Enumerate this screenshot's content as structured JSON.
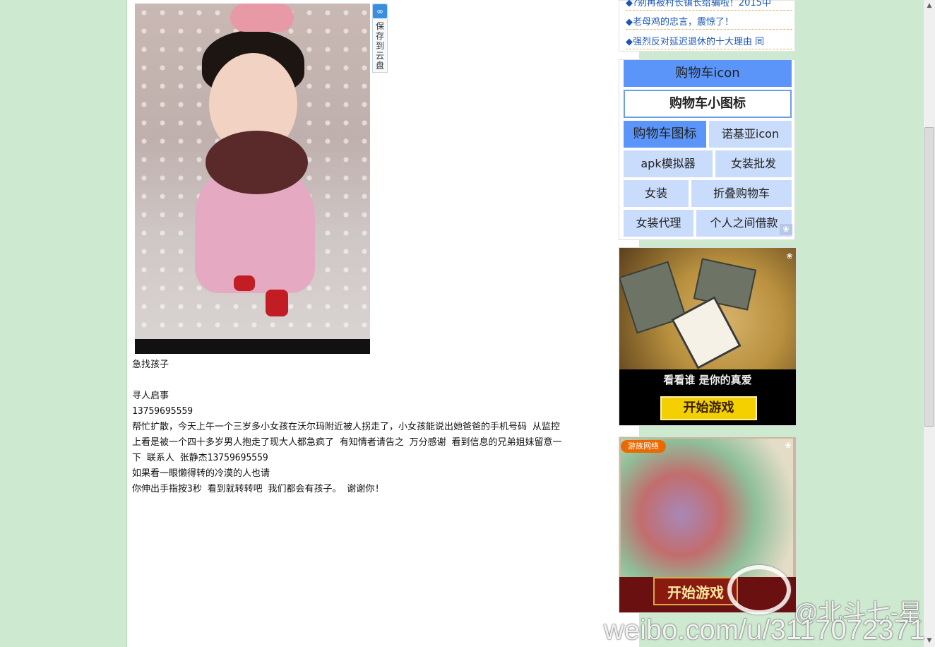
{
  "article": {
    "save_to_cloud": "保存到云盘",
    "lines": [
      "急找孩子",
      "",
      "寻人启事",
      "13759695559",
      "帮忙扩散，今天上午一个三岁多小女孩在沃尔玛附近被人拐走了，小女孩能说出她爸爸的手机号码 从监控",
      "上看是被一个四十多岁男人抱走了现大人都急疯了 有知情者请告之 万分感谢 看到信息的兄弟姐妹留意一",
      "下 联系人 张静杰13759695559",
      "如果看一眼懒得转的冷漠的人也请",
      "你伸出手指按3秒 看到就转转吧 我们都会有孩子。 谢谢你!"
    ]
  },
  "sidebar": {
    "news": [
      {
        "bullet": "◆",
        "text": "?别再被村长镇长给骗啦！2015中"
      },
      {
        "bullet": "◆",
        "text": "老母鸡的忠言，震惊了！"
      },
      {
        "bullet": "◆",
        "text": "强烈反对延迟退休的十大理由 同"
      }
    ],
    "links": [
      {
        "label": "购物车icon"
      },
      {
        "label": "购物车小图标"
      },
      {
        "label": "购物车图标"
      },
      {
        "label": "诺基亚icon"
      },
      {
        "label": "apk模拟器"
      },
      {
        "label": "女装批发"
      },
      {
        "label": "女装"
      },
      {
        "label": "折叠购物车"
      },
      {
        "label": "女装代理"
      },
      {
        "label": "个人之间借款"
      }
    ],
    "ad1": {
      "caption": "看看谁 是你的真爱",
      "button": "开始游戏"
    },
    "ad2": {
      "logo": "游族网络",
      "button": "开始游戏"
    }
  },
  "watermark": {
    "handle": "@北斗七-星",
    "url": "weibo.com/u/3117072371"
  },
  "colors": {
    "background": "#cde9cf",
    "link_blue": "#1b57b9",
    "tag_bg": "#c9dcfb",
    "tag_active": "#5b95f9"
  },
  "icons": {
    "cloud": "cloud-icon",
    "baidu_paw": "paw-icon"
  }
}
